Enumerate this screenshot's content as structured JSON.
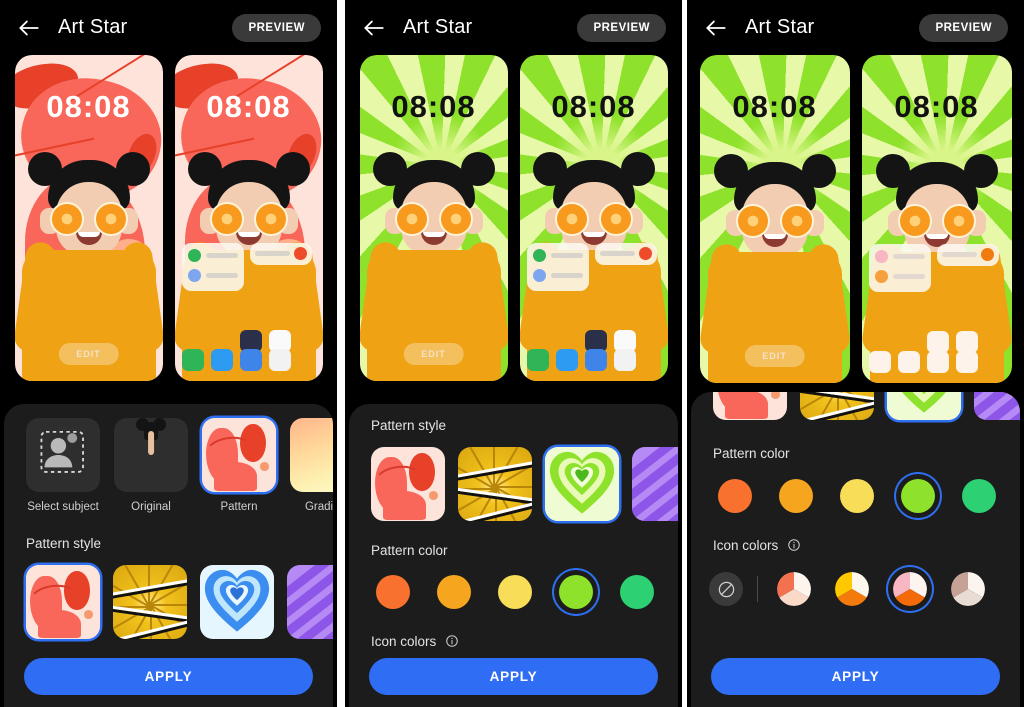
{
  "app": {
    "title": "Art Star",
    "back_icon": "arrow-left-icon",
    "preview_label": "PREVIEW"
  },
  "colors": {
    "accent_blue": "#2f6ef4",
    "sheet_bg": "#1c1c1c",
    "page_bg": "#000000",
    "selected_ring": "#2e6ff2"
  },
  "phone_preview": {
    "clock_time": "08:08",
    "edit_label": "EDIT"
  },
  "panels": [
    {
      "id": "panel-1",
      "wallpaper_theme": "coral",
      "clock_color": "#ffffff",
      "sections": [
        {
          "key": "source",
          "title": ""
        },
        {
          "key": "pattern_style",
          "title": "Pattern style"
        }
      ],
      "source_options": [
        {
          "label": "Select subject",
          "icon": "select-subject-icon",
          "selected": false
        },
        {
          "label": "Original",
          "icon": "original-photo-thumb",
          "selected": false
        },
        {
          "label": "Pattern",
          "icon": "pattern-coral-thumb",
          "selected": true
        },
        {
          "label": "Gradient",
          "icon": "gradient-thumb",
          "selected": false
        }
      ],
      "pattern_styles": [
        {
          "name": "coral-blobs",
          "selected": true
        },
        {
          "name": "comic-burst",
          "selected": false
        },
        {
          "name": "heart-rings",
          "selected": false,
          "color": "#3b8ef0"
        },
        {
          "name": "chevron-lines",
          "selected": false
        }
      ],
      "apply_label": "APPLY"
    },
    {
      "id": "panel-2",
      "wallpaper_theme": "green",
      "clock_color": "#111111",
      "sections": [
        {
          "key": "pattern_style",
          "title": "Pattern style"
        },
        {
          "key": "pattern_color",
          "title": "Pattern color"
        },
        {
          "key": "icon_colors",
          "title": "Icon colors"
        }
      ],
      "pattern_styles": [
        {
          "name": "coral-blobs",
          "selected": false
        },
        {
          "name": "comic-burst",
          "selected": false
        },
        {
          "name": "heart-rings",
          "selected": true,
          "color": "#8fe22b"
        },
        {
          "name": "chevron-lines",
          "selected": false
        }
      ],
      "pattern_colors": [
        {
          "hex": "#f9712e",
          "selected": false
        },
        {
          "hex": "#f6a51e",
          "selected": false
        },
        {
          "hex": "#f8dd59",
          "selected": false
        },
        {
          "hex": "#8fe22b",
          "selected": true
        },
        {
          "hex": "#2dd073",
          "selected": false
        },
        {
          "hex": "#36c6f0",
          "selected": false
        }
      ],
      "icon_colors_title": "Icon colors",
      "apply_label": "APPLY"
    },
    {
      "id": "panel-3",
      "wallpaper_theme": "green",
      "clock_color": "#111111",
      "sections": [
        {
          "key": "pattern_style",
          "title": ""
        },
        {
          "key": "pattern_color",
          "title": "Pattern color"
        },
        {
          "key": "icon_colors",
          "title": "Icon colors"
        }
      ],
      "pattern_styles": [
        {
          "name": "coral-blobs",
          "selected": false
        },
        {
          "name": "comic-burst",
          "selected": false
        },
        {
          "name": "heart-rings",
          "selected": true,
          "color": "#8fe22b"
        },
        {
          "name": "chevron-lines",
          "selected": false
        }
      ],
      "pattern_colors": [
        {
          "hex": "#f9712e",
          "selected": false
        },
        {
          "hex": "#f6a51e",
          "selected": false
        },
        {
          "hex": "#f8dd59",
          "selected": false
        },
        {
          "hex": "#8fe22b",
          "selected": true
        },
        {
          "hex": "#2dd073",
          "selected": false
        },
        {
          "hex": "#36c6f0",
          "selected": false
        }
      ],
      "icon_color_options": [
        {
          "name": "none",
          "icon": "no-color-icon",
          "selected": false
        },
        {
          "name": "coral",
          "segments": [
            "#f4714f",
            "#fdf4ee",
            "#fbd9c8"
          ],
          "selected": false
        },
        {
          "name": "amber",
          "segments": [
            "#ffc800",
            "#fdf6ea",
            "#f57a0c"
          ],
          "selected": false
        },
        {
          "name": "pink-orange",
          "segments": [
            "#f9b7c4",
            "#fdf4ef",
            "#f26b08"
          ],
          "selected": true
        },
        {
          "name": "taupe",
          "segments": [
            "#c6a296",
            "#fbf4ef",
            "#e8dcd4"
          ],
          "selected": false
        }
      ],
      "apply_label": "APPLY"
    }
  ],
  "labels": {
    "pattern_style": "Pattern style",
    "pattern_color": "Pattern color",
    "icon_colors": "Icon colors",
    "select_subject": "Select subject",
    "original": "Original",
    "pattern": "Pattern",
    "gradient": "Gradient",
    "apply": "APPLY",
    "preview": "PREVIEW",
    "title": "Art Star",
    "clock": "08:08",
    "edit": "EDIT"
  }
}
